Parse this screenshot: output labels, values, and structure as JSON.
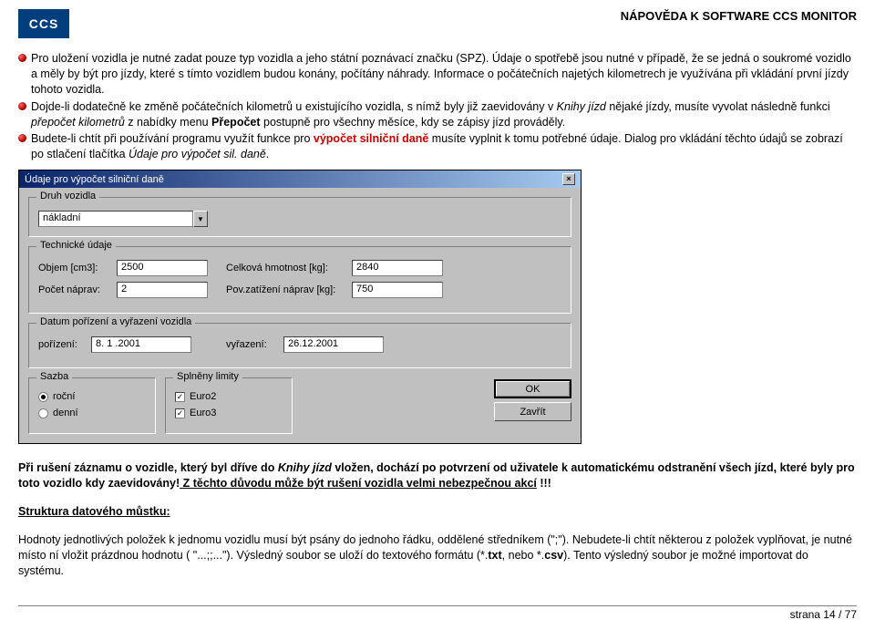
{
  "header": {
    "logo": "CCS",
    "title": "NÁPOVĚDA K SOFTWARE CCS MONITOR"
  },
  "paragraphs": {
    "p1a": "Pro uložení vozidla je nutné zadat pouze typ vozidla a jeho státní poznávací značku (SPZ). Údaje o spotřebě jsou nutné v případě, že se jedná o soukromé vozidlo a měly by být pro jízdy, které s tímto vozidlem budou konány, počítány náhrady. Informace o počátečních najetých kilometrech je využívána při vkládání první jízdy tohoto vozidla.",
    "p2a": "Dojde-li dodatečně ke změně počátečních kilometrů u existujícího vozidla, s nímž byly již zaevidovány v ",
    "p2b": "Knihy jízd",
    "p2c": " nějaké jízdy, musíte vyvolat následně funkci ",
    "p2d": "přepočet kilometrů",
    "p2e": " z nabídky menu ",
    "p2f": "Přepočet",
    "p2g": " postupně pro všechny měsíce, kdy se zápisy jízd prováděly.",
    "p3a": "Budete-li chtít při používání programu využít funkce pro ",
    "p3b": "výpočet silniční daně ",
    "p3c": "musíte vyplnit k tomu potřebné údaje. Dialog pro vkládání těchto údajů se zobrazí po stlačení tlačítka ",
    "p3d": "Údaje pro výpočet sil. daně",
    "p3e": "."
  },
  "dialog": {
    "title": "Údaje pro výpočet silniční daně",
    "close": "×",
    "druhvozidla": {
      "legend": "Druh vozidla",
      "value": "nákladní"
    },
    "technicke": {
      "legend": "Technické údaje",
      "objem_lbl": "Objem [cm3]:",
      "objem": "2500",
      "celkova_lbl": "Celková hmotnost [kg]:",
      "celkova": "2840",
      "pocet_lbl": "Počet náprav:",
      "pocet": "2",
      "pov_lbl": "Pov.zatížení náprav [kg]:",
      "pov": "750"
    },
    "datum": {
      "legend": "Datum pořízení a vyřazení vozidla",
      "porizeni_lbl": "pořízení:",
      "porizeni": "8. 1 .2001",
      "vyrazeni_lbl": "vyřazení:",
      "vyrazeni": "26.12.2001"
    },
    "sazba": {
      "legend": "Sazba",
      "rocni": "roční",
      "denni": "denní"
    },
    "limity": {
      "legend": "Splněny limity",
      "euro2": "Euro2",
      "euro3": "Euro3"
    },
    "buttons": {
      "ok": "OK",
      "zavrit": "Zavřít"
    }
  },
  "notes": {
    "n1a": "Při rušení záznamu o vozidle, který byl dříve do ",
    "n1b": "Knihy jízd",
    "n1c": " vložen, dochází po potvrzení od uživatele k automatickému odstranění všech jízd, které byly pro toto vozidlo kdy zaevidovány!",
    "n1d": " Z těchto důvodu může být rušení vozidla velmi nebezpečnou akcí",
    "n1e": " !!!",
    "n2": "Struktura datového můstku:",
    "n3a": "Hodnoty jednotlivých položek k jednomu vozidlu musí být psány do jednoho řádku, oddělené středníkem (\";\"). Nebudete-li chtít některou z položek vyplňovat, je nutné místo ní vložit prázdnou hodnotu ( \"...;;...\"). Výsledný soubor se uloží do textového formátu (*.",
    "n3b": "txt",
    "n3c": ", nebo *.",
    "n3d": "csv",
    "n3e": "). Tento výsledný soubor je možné importovat do systému."
  },
  "footer": {
    "page": "strana 14 / 77"
  }
}
